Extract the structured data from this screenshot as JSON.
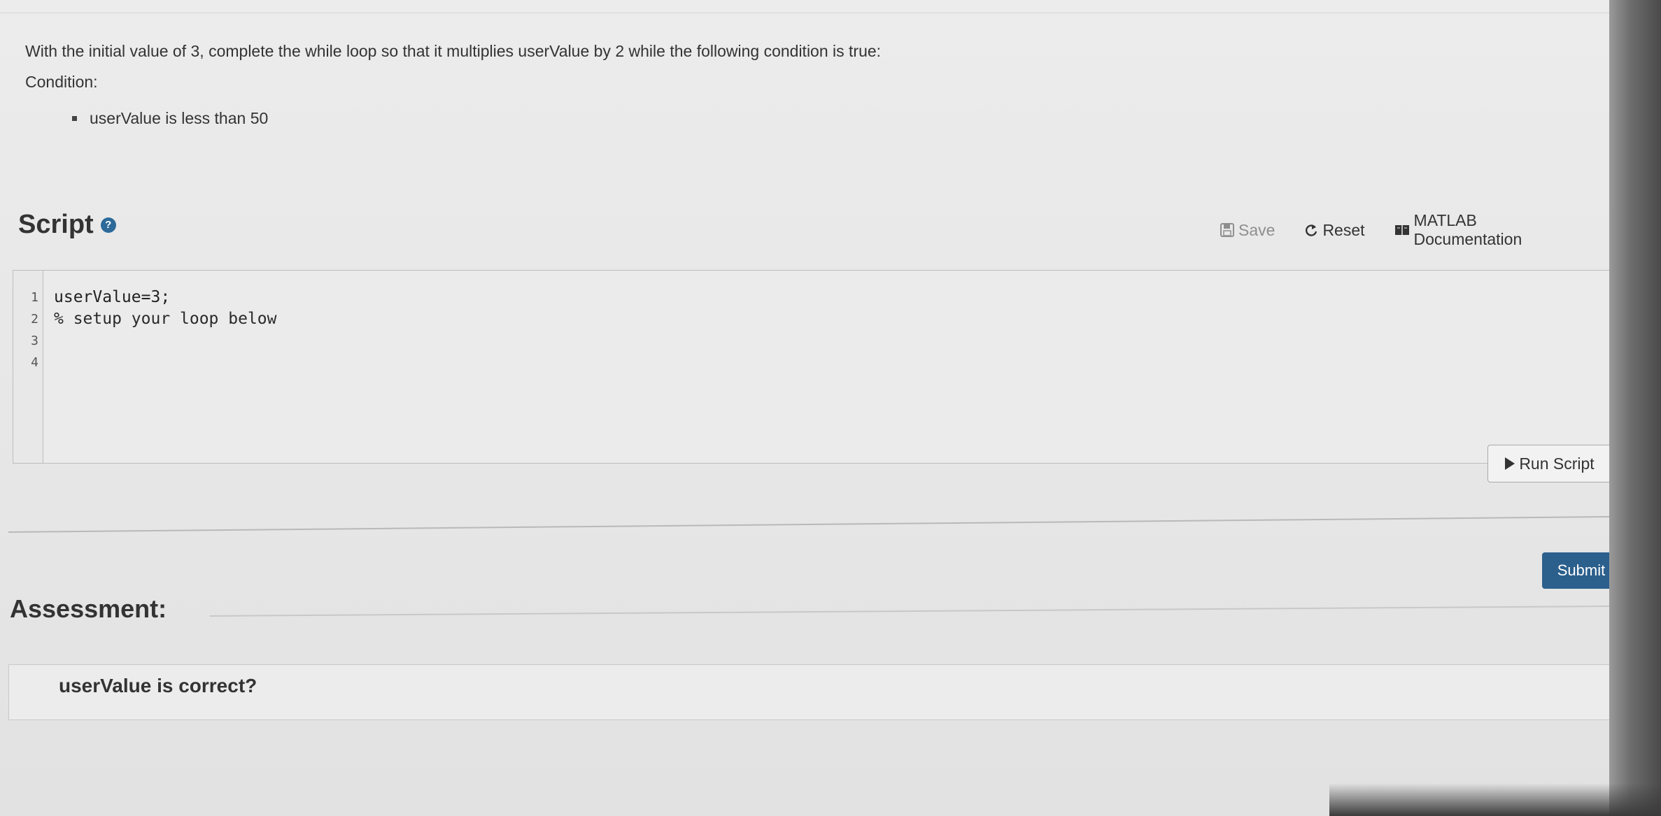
{
  "problem": {
    "instructions": "With the initial value of 3, complete the while loop so that it multiplies userValue by 2 while the following condition is true:",
    "condition_label": "Condition:",
    "conditions": [
      "userValue is less than 50"
    ]
  },
  "script": {
    "title": "Script",
    "help_icon": "question-circle-icon",
    "toolbar": {
      "save_label": "Save",
      "reset_label": "Reset",
      "docs_label": "MATLAB Documentation"
    },
    "line_numbers": [
      "1",
      "2",
      "3",
      "4"
    ],
    "code_lines": [
      "userValue=3;",
      "% setup your loop below",
      "",
      ""
    ],
    "run_label": "Run Script"
  },
  "actions": {
    "submit_label": "Submit"
  },
  "assessment": {
    "title": "Assessment:",
    "items": [
      "userValue is correct?"
    ]
  },
  "colors": {
    "accent": "#2b5f8c",
    "help_icon": "#2d6a9a",
    "save_disabled": "#8e8e8e"
  }
}
